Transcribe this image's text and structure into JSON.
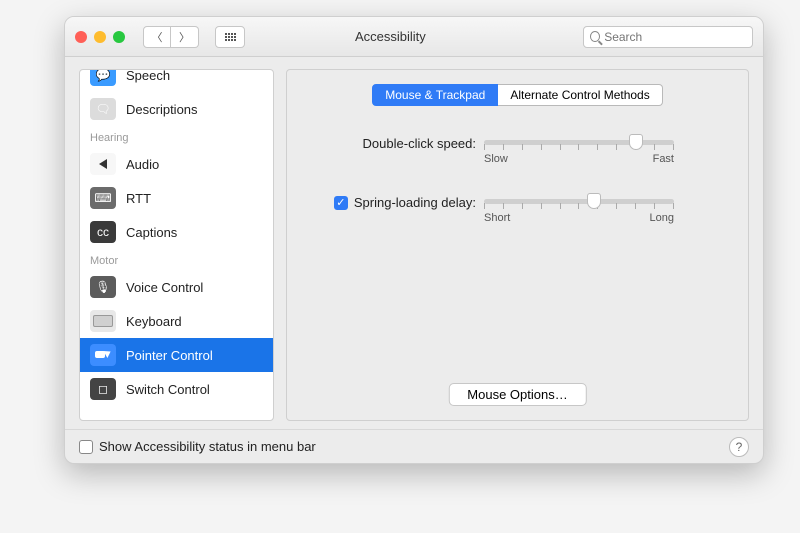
{
  "window": {
    "title": "Accessibility"
  },
  "search": {
    "placeholder": "Search"
  },
  "sidebar": {
    "sections": [
      {
        "items": [
          {
            "label": "Speech",
            "partial": true
          },
          {
            "label": "Descriptions"
          }
        ]
      },
      {
        "header": "Hearing",
        "items": [
          {
            "label": "Audio"
          },
          {
            "label": "RTT"
          },
          {
            "label": "Captions"
          }
        ]
      },
      {
        "header": "Motor",
        "items": [
          {
            "label": "Voice Control"
          },
          {
            "label": "Keyboard"
          },
          {
            "label": "Pointer Control",
            "selected": true
          },
          {
            "label": "Switch Control"
          }
        ]
      }
    ]
  },
  "tabs": {
    "items": [
      {
        "label": "Mouse & Trackpad",
        "active": true
      },
      {
        "label": "Alternate Control Methods",
        "active": false
      }
    ]
  },
  "settings": {
    "double_click": {
      "label": "Double-click speed:",
      "min_label": "Slow",
      "max_label": "Fast",
      "value_percent": 80
    },
    "spring_loading": {
      "label": "Spring-loading delay:",
      "checked": true,
      "min_label": "Short",
      "max_label": "Long",
      "value_percent": 58
    }
  },
  "buttons": {
    "mouse_options": "Mouse Options…"
  },
  "footer": {
    "checkbox_label": "Show Accessibility status in menu bar",
    "checked": false
  }
}
